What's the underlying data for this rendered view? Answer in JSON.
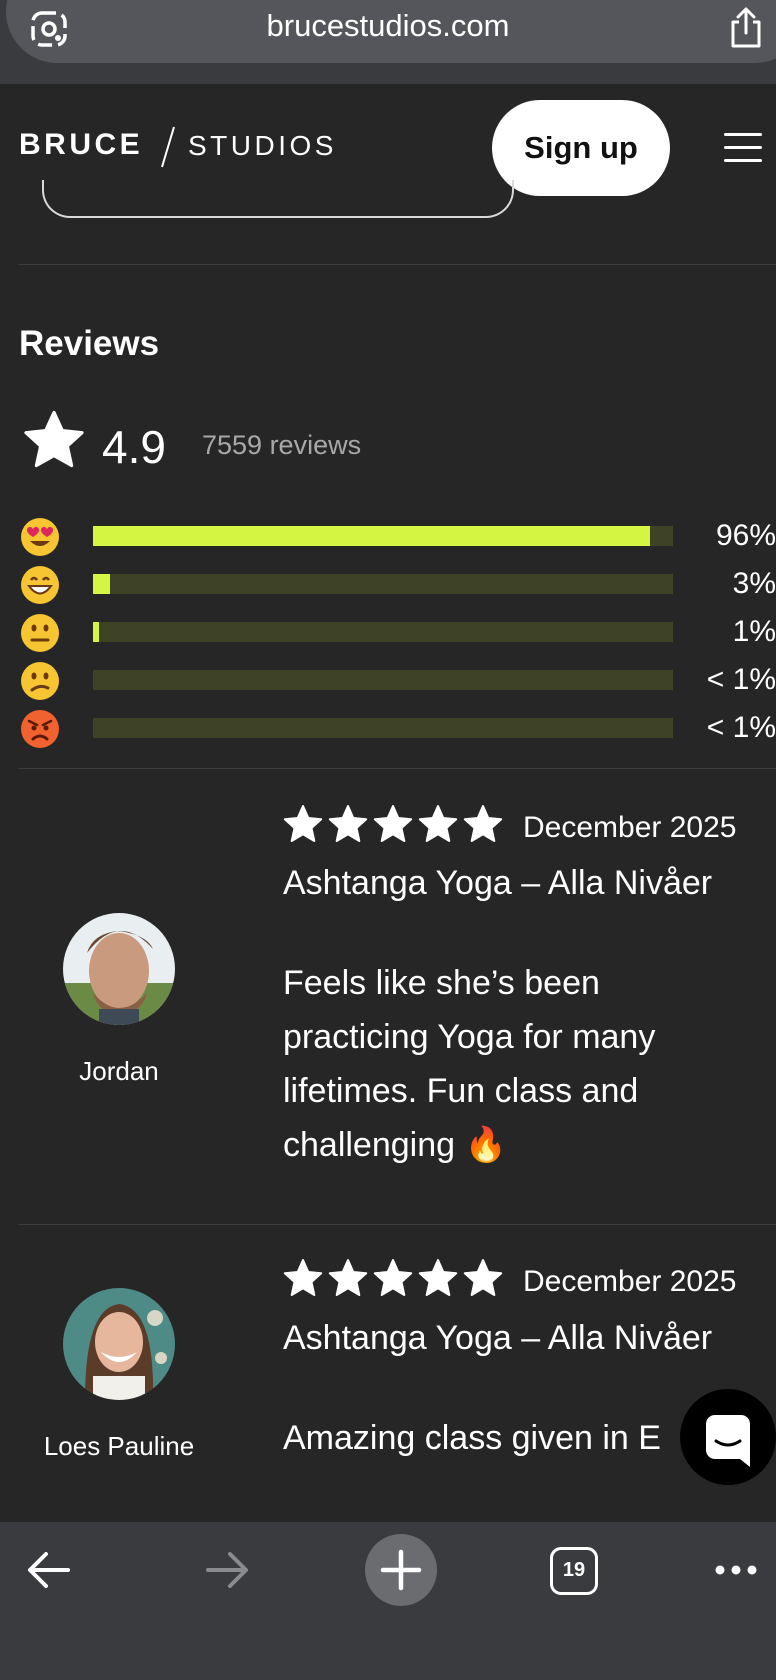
{
  "browser": {
    "url": "brucestudios.com",
    "tab_count": "19",
    "icons": [
      "lens-icon",
      "share-icon",
      "back-icon",
      "forward-icon",
      "new-tab-icon",
      "tabs-icon",
      "more-icon"
    ]
  },
  "header": {
    "logo_bruce": "BRUCE",
    "logo_studios": "STUDIOS",
    "signup_label": "Sign up"
  },
  "reviews": {
    "title": "Reviews",
    "average": "4.9",
    "count": "7559 reviews",
    "accent_color": "#d4f542",
    "distribution": [
      {
        "emoji": "😍",
        "percent_label": "96%",
        "fraction": 0.96
      },
      {
        "emoji": "😄",
        "percent_label": "3%",
        "fraction": 0.03
      },
      {
        "emoji": "😐",
        "percent_label": "1%",
        "fraction": 0.01
      },
      {
        "emoji": "😕",
        "percent_label": "< 1%",
        "fraction": 0.0
      },
      {
        "emoji": "😡",
        "percent_label": "< 1%",
        "fraction": 0.0
      }
    ],
    "items": [
      {
        "name": "Jordan",
        "stars": 5,
        "date": "December 2025",
        "class": "Ashtanga Yoga – Alla Nivåer",
        "text_lines": [
          "Feels like she’s been",
          "practicing Yoga for many",
          "lifetimes. Fun class and",
          "challenging 🔥"
        ]
      },
      {
        "name": "Loes Pauline",
        "stars": 5,
        "date": "December 2025",
        "class": "Ashtanga Yoga – Alla Nivåer",
        "text_lines": [
          "Amazing class given in E"
        ]
      }
    ]
  }
}
